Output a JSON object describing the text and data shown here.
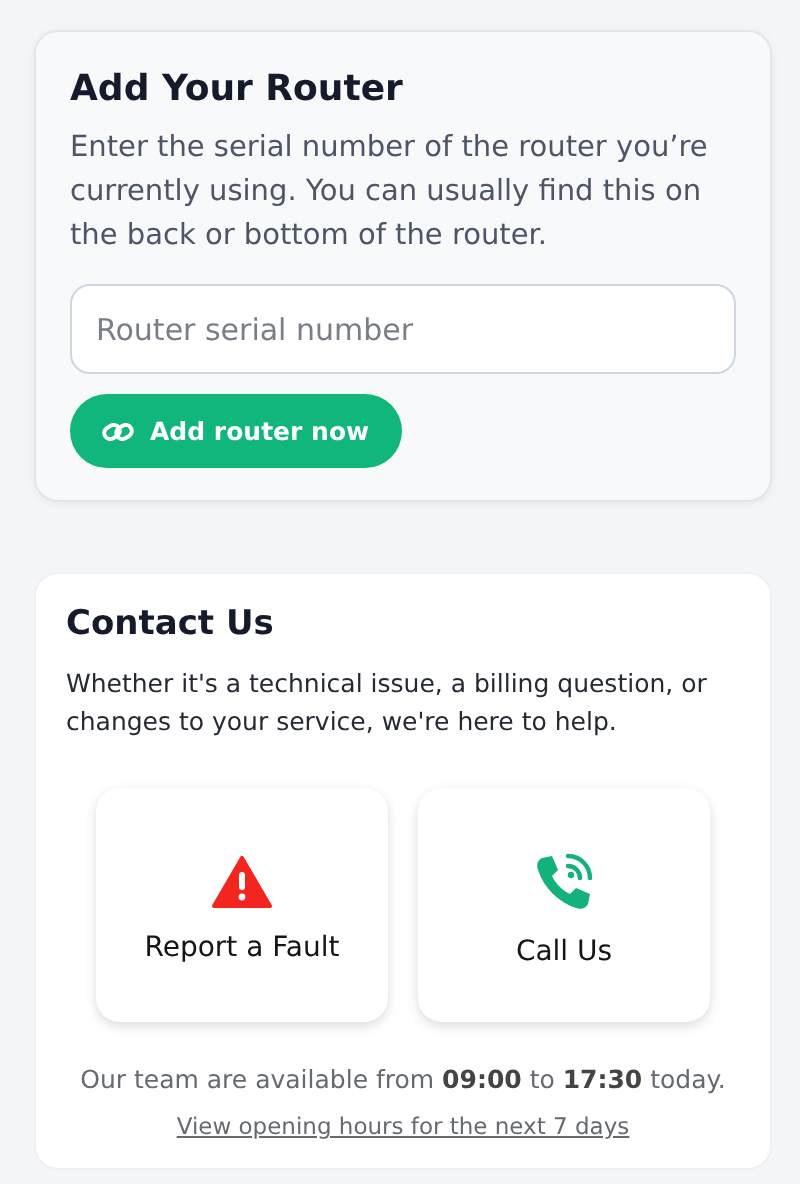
{
  "router_card": {
    "title": "Add Your Router",
    "description": "Enter the serial number of the router you’re currently using. You can usually find this on the back or bottom of the router.",
    "serial_field": {
      "placeholder": "Router serial number"
    },
    "button": {
      "label": "Add router now"
    }
  },
  "contact_card": {
    "title": "Contact Us",
    "description": "Whether it's a technical issue, a billing question, or changes to your service, we're here to help.",
    "actions": [
      {
        "kind": "fault",
        "label": "Report a Fault"
      },
      {
        "kind": "call",
        "label": "Call Us"
      }
    ],
    "availability": "Our team are available from **09:00** to **17:30** today.",
    "hours_link": "View opening hours for the next 7 days"
  }
}
